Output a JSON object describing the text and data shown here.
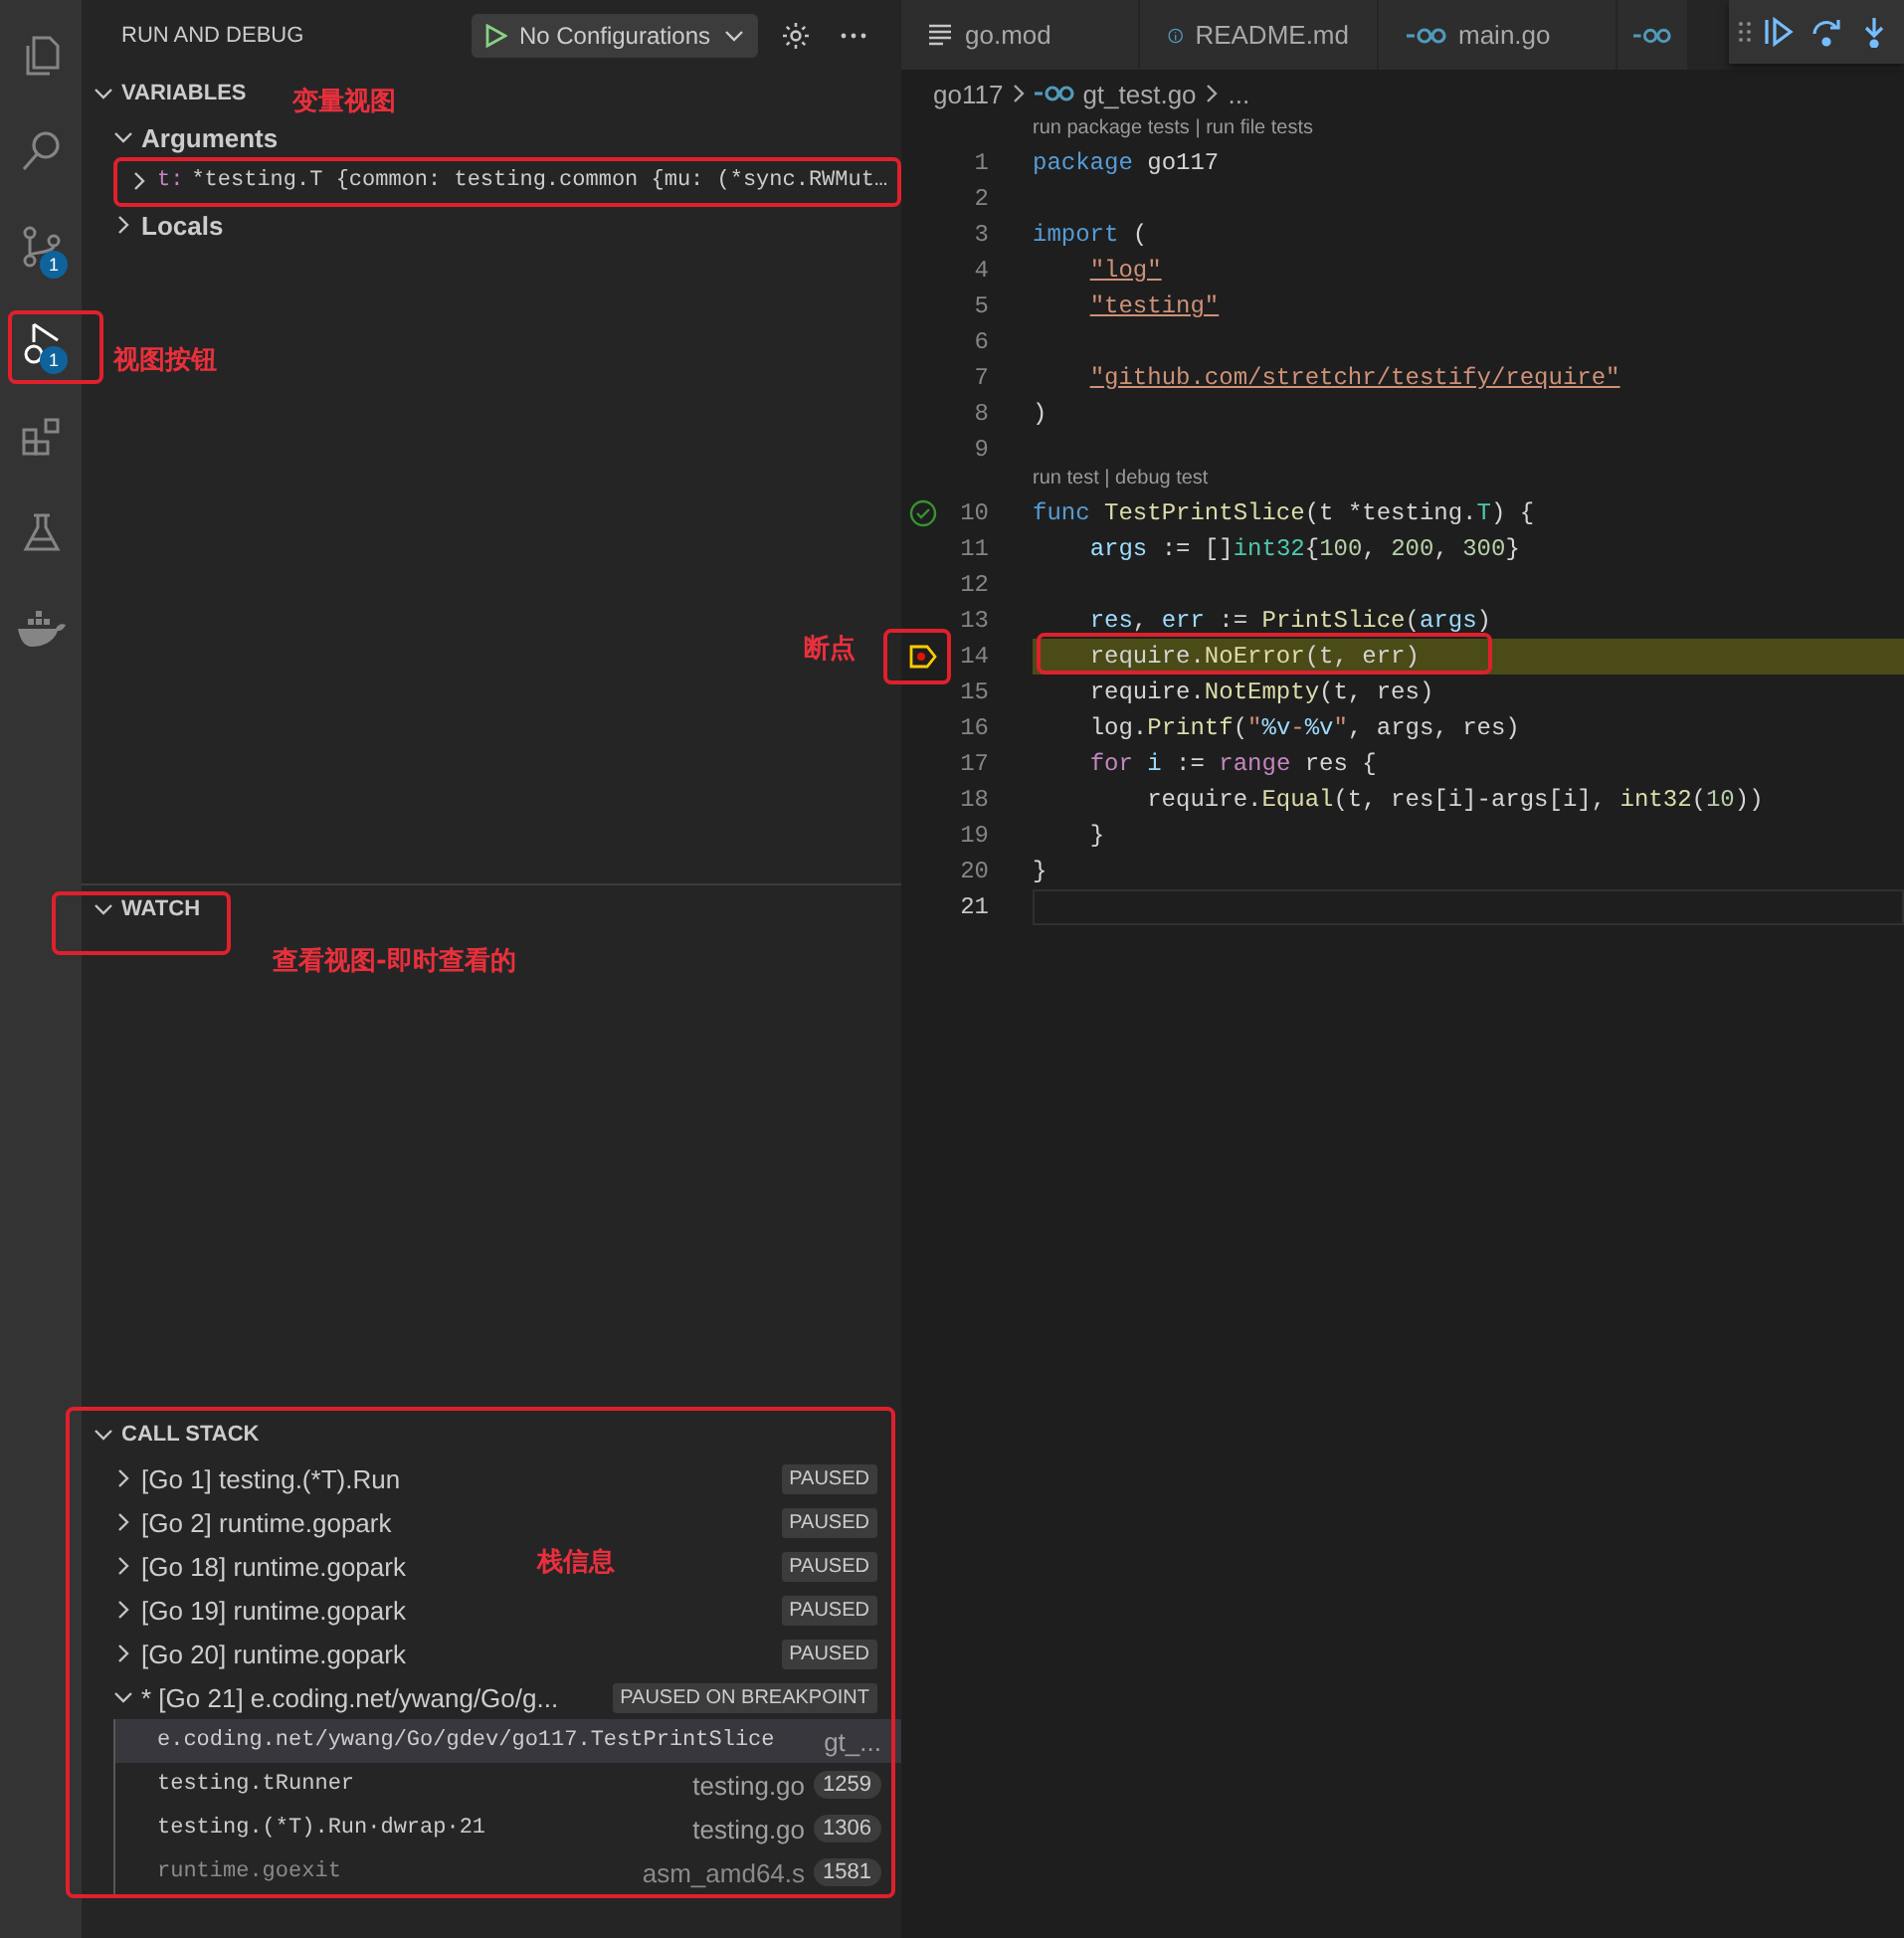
{
  "activity_bar": [
    {
      "kind": "files",
      "selected": false
    },
    {
      "kind": "search",
      "selected": false
    },
    {
      "kind": "source-control",
      "selected": false,
      "badge": "1"
    },
    {
      "kind": "debug",
      "selected": true,
      "badge": "1"
    },
    {
      "kind": "extensions",
      "selected": false
    },
    {
      "kind": "testing",
      "selected": false
    },
    {
      "kind": "docker",
      "selected": false
    }
  ],
  "sidebar": {
    "title": "RUN AND DEBUG",
    "config": "No Configurations",
    "variables": {
      "title": "VARIABLES",
      "expanded": true,
      "groups": [
        {
          "label": "Arguments",
          "expanded": true,
          "items": [
            {
              "name": "t:",
              "value": "*testing.T {common: testing.common {mu: (*sync.RWMut…"
            }
          ]
        },
        {
          "label": "Locals",
          "expanded": false
        }
      ]
    },
    "watch": {
      "title": "WATCH",
      "expanded": true
    },
    "call_stack": {
      "title": "CALL STACK",
      "expanded": true,
      "threads": [
        {
          "label": "[Go 1] testing.(*T).Run",
          "badge": "PAUSED",
          "expanded": false
        },
        {
          "label": "[Go 2] runtime.gopark",
          "badge": "PAUSED",
          "expanded": false
        },
        {
          "label": "[Go 18] runtime.gopark",
          "badge": "PAUSED",
          "expanded": false
        },
        {
          "label": "[Go 19] runtime.gopark",
          "badge": "PAUSED",
          "expanded": false
        },
        {
          "label": "[Go 20] runtime.gopark",
          "badge": "PAUSED",
          "expanded": false
        },
        {
          "label": "* [Go 21] e.coding.net/ywang/Go/g...",
          "badge": "PAUSED ON BREAKPOINT",
          "expanded": true,
          "frames": [
            {
              "name": "e.coding.net/ywang/Go/gdev/go117.TestPrintSlice",
              "file": "gt_...",
              "selected": true,
              "dim": false
            },
            {
              "name": "testing.tRunner",
              "file": "testing.go",
              "line": "1259",
              "selected": false,
              "dim": false
            },
            {
              "name": "testing.(*T).Run·dwrap·21",
              "file": "testing.go",
              "line": "1306",
              "selected": false,
              "dim": false
            },
            {
              "name": "runtime.goexit",
              "file": "asm_amd64.s",
              "line": "1581",
              "selected": false,
              "dim": true
            }
          ]
        }
      ]
    }
  },
  "editor": {
    "tabs": [
      {
        "kind": "lines",
        "label": "go.mod",
        "selected": false
      },
      {
        "kind": "info",
        "label": "README.md",
        "selected": false
      },
      {
        "kind": "go",
        "label": "main.go",
        "selected": false
      },
      {
        "kind": "go",
        "selected": false
      }
    ],
    "breadcrumb": [
      "go117",
      "gt_test.go",
      "..."
    ],
    "lines": [
      {
        "number": "1",
        "codelens": "run package tests | run file tests",
        "tokens": [
          {
            "kind": "kw",
            "text": "package"
          },
          {
            "kind": "p",
            "text": " go117"
          }
        ]
      },
      {
        "number": "2"
      },
      {
        "number": "3",
        "tokens": [
          {
            "kind": "kw",
            "text": "import"
          },
          {
            "kind": "p",
            "text": " ("
          }
        ]
      },
      {
        "number": "4",
        "tokens": [
          {
            "kind": "link",
            "text": "    \"log\""
          }
        ]
      },
      {
        "number": "5",
        "tokens": [
          {
            "kind": "link",
            "text": "    \"testing\""
          }
        ]
      },
      {
        "number": "6"
      },
      {
        "number": "7",
        "tokens": [
          {
            "kind": "link",
            "text": "    \"github.com/stretchr/testify/require\""
          }
        ]
      },
      {
        "number": "8",
        "tokens": [
          {
            "kind": "p",
            "text": ")"
          }
        ]
      },
      {
        "number": "9"
      },
      {
        "number": "10",
        "codelens": "run test | debug test",
        "gutter": {
          "kind": "pass"
        },
        "tokens": [
          {
            "kind": "kw",
            "text": "func"
          },
          {
            "kind": "fn",
            "text": " TestPrintSlice"
          },
          {
            "kind": "p",
            "text": "(t *testing."
          },
          {
            "kind": "type",
            "text": "T"
          },
          {
            "kind": "p",
            "text": ") {"
          }
        ]
      },
      {
        "number": "11",
        "tokens": [
          {
            "kind": "var",
            "text": "    args"
          },
          {
            "kind": "p",
            "text": " := []"
          },
          {
            "kind": "type",
            "text": "int32"
          },
          {
            "kind": "p",
            "text": "{"
          },
          {
            "kind": "num",
            "text": "100"
          },
          {
            "kind": "p",
            "text": ", "
          },
          {
            "kind": "num",
            "text": "200"
          },
          {
            "kind": "p",
            "text": ", "
          },
          {
            "kind": "num",
            "text": "300"
          },
          {
            "kind": "p",
            "text": "}"
          }
        ]
      },
      {
        "number": "12"
      },
      {
        "number": "13",
        "tokens": [
          {
            "kind": "var",
            "text": "    res"
          },
          {
            "kind": "p",
            "text": ", "
          },
          {
            "kind": "var",
            "text": "err"
          },
          {
            "kind": "p",
            "text": " := "
          },
          {
            "kind": "fn",
            "text": "PrintSlice"
          },
          {
            "kind": "p",
            "text": "("
          },
          {
            "kind": "var",
            "text": "args"
          },
          {
            "kind": "p",
            "text": ")"
          }
        ]
      },
      {
        "number": "14",
        "gutter": {
          "kind": "breakpoint"
        },
        "highlighted": true,
        "tokens": [
          {
            "kind": "p",
            "text": "    require."
          },
          {
            "kind": "fn",
            "text": "NoError"
          },
          {
            "kind": "p",
            "text": "(t, err)"
          }
        ]
      },
      {
        "number": "15",
        "tokens": [
          {
            "kind": "p",
            "text": "    require."
          },
          {
            "kind": "fn",
            "text": "NotEmpty"
          },
          {
            "kind": "p",
            "text": "(t, res)"
          }
        ]
      },
      {
        "number": "16",
        "tokens": [
          {
            "kind": "p",
            "text": "    log."
          },
          {
            "kind": "fn",
            "text": "Printf"
          },
          {
            "kind": "p",
            "text": "("
          },
          {
            "kind": "str",
            "text": "\""
          },
          {
            "kind": "var",
            "text": "%v"
          },
          {
            "kind": "str",
            "text": "-"
          },
          {
            "kind": "var",
            "text": "%v"
          },
          {
            "kind": "str",
            "text": "\""
          },
          {
            "kind": "p",
            "text": ", args, res)"
          }
        ]
      },
      {
        "number": "17",
        "tokens": [
          {
            "kind": "ctl",
            "text": "    for"
          },
          {
            "kind": "var",
            "text": " i"
          },
          {
            "kind": "p",
            "text": " := "
          },
          {
            "kind": "ctl",
            "text": "range"
          },
          {
            "kind": "p",
            "text": " res {"
          }
        ]
      },
      {
        "number": "18",
        "tokens": [
          {
            "kind": "p",
            "text": "        require."
          },
          {
            "kind": "fn",
            "text": "Equal"
          },
          {
            "kind": "p",
            "text": "(t, res[i]-args[i], "
          },
          {
            "kind": "fn",
            "text": "int32"
          },
          {
            "kind": "p",
            "text": "("
          },
          {
            "kind": "num",
            "text": "10"
          },
          {
            "kind": "p",
            "text": "))"
          }
        ]
      },
      {
        "number": "19",
        "tokens": [
          {
            "kind": "p",
            "text": "    }"
          }
        ]
      },
      {
        "number": "20",
        "tokens": [
          {
            "kind": "p",
            "text": "}"
          }
        ]
      },
      {
        "number": "21",
        "cursor": true
      }
    ]
  },
  "annotations": [
    "变量视图",
    "视图按钮",
    "断点",
    "查看视图-即时查看的",
    "栈信息"
  ]
}
